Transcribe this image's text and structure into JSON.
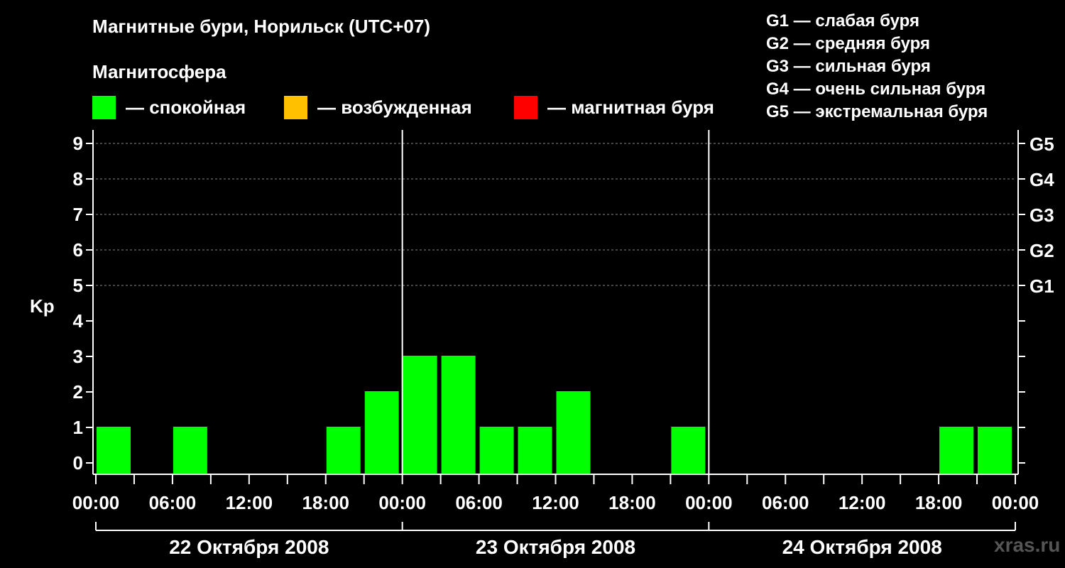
{
  "title": "Магнитные бури, Норильск (UTC+07)",
  "subtitle": "Магнитосфера",
  "legend": [
    {
      "label": "— спокойная",
      "color": "#00ff00"
    },
    {
      "label": "— возбужденная",
      "color": "#ffc000"
    },
    {
      "label": "— магнитная буря",
      "color": "#ff0000"
    }
  ],
  "storm_scale": [
    "G1 — слабая буря",
    "G2 — средняя буря",
    "G3 — сильная буря",
    "G4 — очень сильная буря",
    "G5 — экстремальная буря"
  ],
  "watermark": "xras.ru",
  "chart_data": {
    "type": "bar",
    "ylabel": "Kp",
    "ylim": [
      0,
      9
    ],
    "yticks": [
      "0",
      "1",
      "2",
      "3",
      "4",
      "5",
      "6",
      "7",
      "8",
      "9"
    ],
    "right_ticks": [
      {
        "kp": 5,
        "label": "G1"
      },
      {
        "kp": 6,
        "label": "G2"
      },
      {
        "kp": 7,
        "label": "G3"
      },
      {
        "kp": 8,
        "label": "G4"
      },
      {
        "kp": 9,
        "label": "G5"
      }
    ],
    "xtick_labels": [
      "00:00",
      "06:00",
      "12:00",
      "18:00",
      "00:00",
      "06:00",
      "12:00",
      "18:00",
      "00:00",
      "06:00",
      "12:00",
      "18:00",
      "00:00"
    ],
    "days": [
      "22 Октября 2008",
      "23 Октября 2008",
      "24 Октября 2008"
    ],
    "interval_hours": 3,
    "grid": "dashed horizontal at Kp 5–9",
    "bars": [
      {
        "start": "22.10 00:00",
        "kp": 1,
        "level": "calm"
      },
      {
        "start": "22.10 03:00",
        "kp": 0,
        "level": "calm"
      },
      {
        "start": "22.10 06:00",
        "kp": 1,
        "level": "calm"
      },
      {
        "start": "22.10 09:00",
        "kp": 0,
        "level": "calm"
      },
      {
        "start": "22.10 12:00",
        "kp": 0,
        "level": "calm"
      },
      {
        "start": "22.10 15:00",
        "kp": 0,
        "level": "calm"
      },
      {
        "start": "22.10 18:00",
        "kp": 1,
        "level": "calm"
      },
      {
        "start": "22.10 21:00",
        "kp": 2,
        "level": "calm"
      },
      {
        "start": "23.10 00:00",
        "kp": 3,
        "level": "calm"
      },
      {
        "start": "23.10 03:00",
        "kp": 3,
        "level": "calm"
      },
      {
        "start": "23.10 06:00",
        "kp": 1,
        "level": "calm"
      },
      {
        "start": "23.10 09:00",
        "kp": 1,
        "level": "calm"
      },
      {
        "start": "23.10 12:00",
        "kp": 2,
        "level": "calm"
      },
      {
        "start": "23.10 15:00",
        "kp": 0,
        "level": "calm"
      },
      {
        "start": "23.10 18:00",
        "kp": 0,
        "level": "calm"
      },
      {
        "start": "23.10 21:00",
        "kp": 1,
        "level": "calm"
      },
      {
        "start": "24.10 00:00",
        "kp": 0,
        "level": "calm"
      },
      {
        "start": "24.10 03:00",
        "kp": 0,
        "level": "calm"
      },
      {
        "start": "24.10 06:00",
        "kp": 0,
        "level": "calm"
      },
      {
        "start": "24.10 09:00",
        "kp": 0,
        "level": "calm"
      },
      {
        "start": "24.10 12:00",
        "kp": 0,
        "level": "calm"
      },
      {
        "start": "24.10 15:00",
        "kp": 0,
        "level": "calm"
      },
      {
        "start": "24.10 18:00",
        "kp": 1,
        "level": "calm"
      },
      {
        "start": "24.10 21:00",
        "kp": 1,
        "level": "calm"
      }
    ]
  }
}
